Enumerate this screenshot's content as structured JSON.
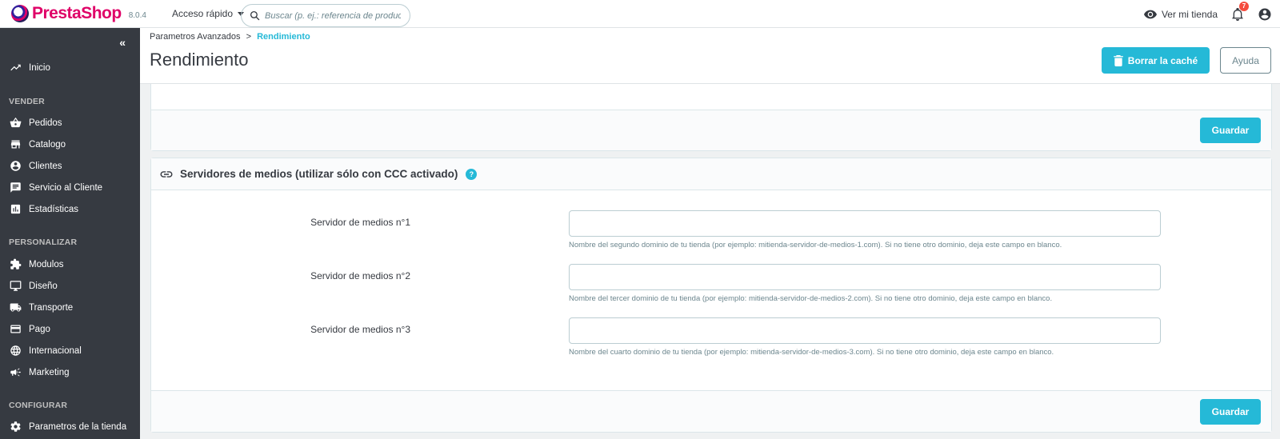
{
  "header": {
    "brand": "PrestaShop",
    "version": "8.0.4",
    "quick_access": "Acceso rápido",
    "search_placeholder": "Buscar (p. ej.: referencia de producto,",
    "view_store": "Ver mi tienda",
    "notifications_count": "7"
  },
  "sidebar": {
    "collapse": "«",
    "home": "Inicio",
    "sections": [
      {
        "title": "VENDER",
        "items": [
          "Pedidos",
          "Catalogo",
          "Clientes",
          "Servicio al Cliente",
          "Estadísticas"
        ]
      },
      {
        "title": "PERSONALIZAR",
        "items": [
          "Modulos",
          "Diseño",
          "Transporte",
          "Pago",
          "Internacional",
          "Marketing"
        ]
      },
      {
        "title": "CONFIGURAR",
        "items": [
          "Parametros de la tienda"
        ]
      }
    ]
  },
  "page": {
    "breadcrumb_parent": "Parametros Avanzados",
    "breadcrumb_sep": ">",
    "breadcrumb_current": "Rendimiento",
    "title": "Rendimiento",
    "clear_cache": "Borrar la caché",
    "help": "Ayuda"
  },
  "panel_top": {
    "save": "Guardar"
  },
  "media_panel": {
    "title": "Servidores de medios (utilizar sólo con CCC activado)",
    "help_icon": "?",
    "fields": [
      {
        "label": "Servidor de medios n°1",
        "value": "",
        "help": "Nombre del segundo dominio de tu tienda (por ejemplo: mitienda-servidor-de-medios-1.com). Si no tiene otro dominio, deja este campo en blanco."
      },
      {
        "label": "Servidor de medios n°2",
        "value": "",
        "help": "Nombre del tercer dominio de tu tienda (por ejemplo: mitienda-servidor-de-medios-2.com). Si no tiene otro dominio, deja este campo en blanco."
      },
      {
        "label": "Servidor de medios n°3",
        "value": "",
        "help": "Nombre del cuarto dominio de tu tienda (por ejemplo: mitienda-servidor-de-medios-3.com). Si no tiene otro dominio, deja este campo en blanco."
      }
    ],
    "save": "Guardar"
  },
  "colors": {
    "primary": "#25b9d7",
    "sidebar": "#363a41",
    "brand": "#df0067"
  }
}
